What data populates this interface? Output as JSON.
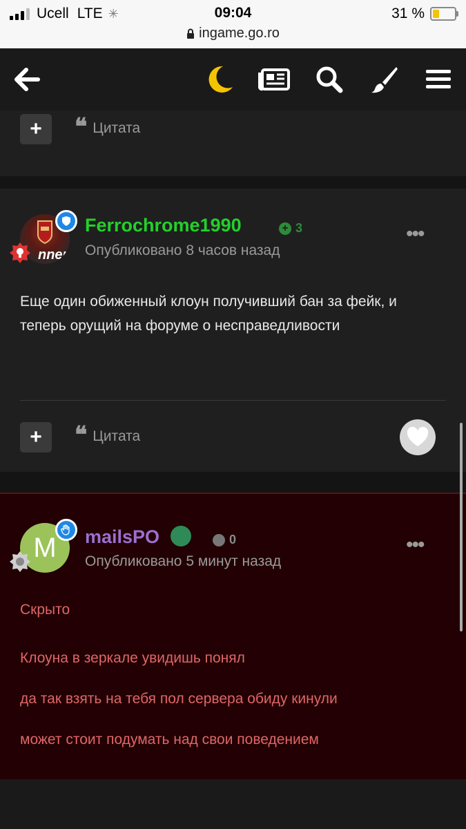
{
  "status_bar": {
    "carrier": "Ucell",
    "network": "LTE",
    "time": "09:04",
    "url": "ingame.go.ro",
    "battery": "31 %",
    "battery_level": 0.31
  },
  "navbar": {
    "icons": [
      "back-arrow-icon",
      "moon-icon",
      "news-icon",
      "search-icon",
      "brush-icon",
      "menu-icon"
    ],
    "accent_color": "#f5c400"
  },
  "posts": [
    {
      "actions": {
        "quote_label": "Цитата"
      }
    },
    {
      "username": "Ferrochrome1990",
      "username_color": "#22d12a",
      "reputation": "3",
      "published": "Опубликовано 8 часов назад",
      "avatar_text": "nner",
      "body": "Еще один обиженный клоун получивший бан за фейк, и теперь орущий на форуме о несправедливости",
      "actions": {
        "quote_label": "Цитата"
      }
    },
    {
      "username": "mailsPO",
      "username_color": "#9b6fd0",
      "reputation": "0",
      "avatar_letter": "M",
      "published": "Опубликовано 5 минут назад",
      "lines": [
        "Скрыто",
        "Клоуна в зеркале увидишь понял",
        "да так взять на тебя пол сервера обиду кинули",
        "может стоит подумать над свои поведением"
      ],
      "text_color": "#e06668"
    }
  ]
}
